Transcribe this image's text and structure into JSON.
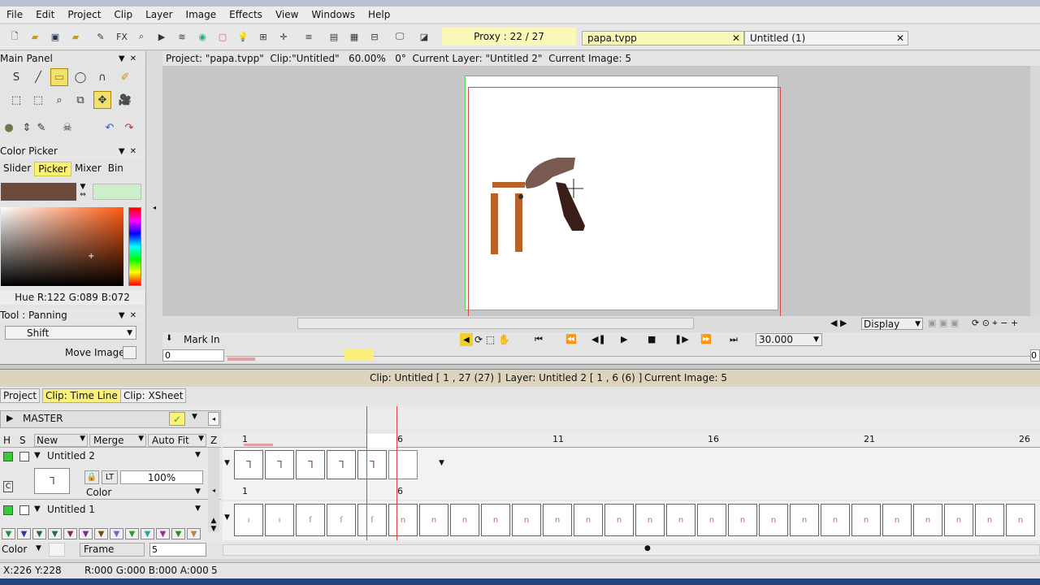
{
  "menu": [
    "File",
    "Edit",
    "Project",
    "Clip",
    "Layer",
    "Image",
    "Effects",
    "View",
    "Windows",
    "Help"
  ],
  "proxy": "Proxy : 22 / 27",
  "tabs": [
    {
      "label": "papa.tvpp"
    },
    {
      "label": "Untitled (1)"
    }
  ],
  "main_panel": {
    "title": "Main Panel"
  },
  "color_picker": {
    "title": "Color Picker",
    "tabs": [
      "Slider",
      "Picker",
      "Mixer",
      "Bin"
    ],
    "readout": "Hue R:122 G:089 B:072",
    "primary": "#6e4a3c",
    "secondary": "#cdeecb"
  },
  "tool_panel": {
    "title": "Tool : Panning",
    "mode": "Shift",
    "move_image": "Move Image"
  },
  "canvas": {
    "info": "Project: \"papa.tvpp\"  Clip:\"Untitled\"   60.00%   0°  Current Layer: \"Untitled 2\"  Current Image: 5"
  },
  "transport": {
    "mark_in": "Mark In",
    "frame_input": "0",
    "fps": "30.000",
    "display": "Display",
    "right_input": "0"
  },
  "status_mid": {
    "clip": "Clip: Untitled [ 1 , 27  (27) ]",
    "layer": "Layer: Untitled 2 [ 1 , 6  (6) ]",
    "current": "Current Image: 5"
  },
  "bottom_tabs": [
    "Project",
    "Clip: Time Line",
    "Clip: XSheet"
  ],
  "timeline": {
    "master": "MASTER",
    "headers": {
      "h": "H",
      "s": "S",
      "new": "New",
      "merge": "Merge",
      "autofit": "Auto Fit",
      "z": "Z"
    },
    "ruler": [
      "1",
      "6",
      "11",
      "16",
      "21",
      "26"
    ],
    "layer2": {
      "name": "Untitled 2",
      "opacity": "100%",
      "mode": "Color",
      "lt": "LT",
      "c": "C",
      "start": "1",
      "end": "6"
    },
    "layer1": {
      "name": "Untitled 1"
    },
    "color_label": "Color",
    "frame_label": "Frame",
    "frame_value": "5"
  },
  "status_bar": {
    "coords": "X:226  Y:228",
    "rgba": "R:000 G:000 B:000 A:000",
    "frame": "5"
  }
}
